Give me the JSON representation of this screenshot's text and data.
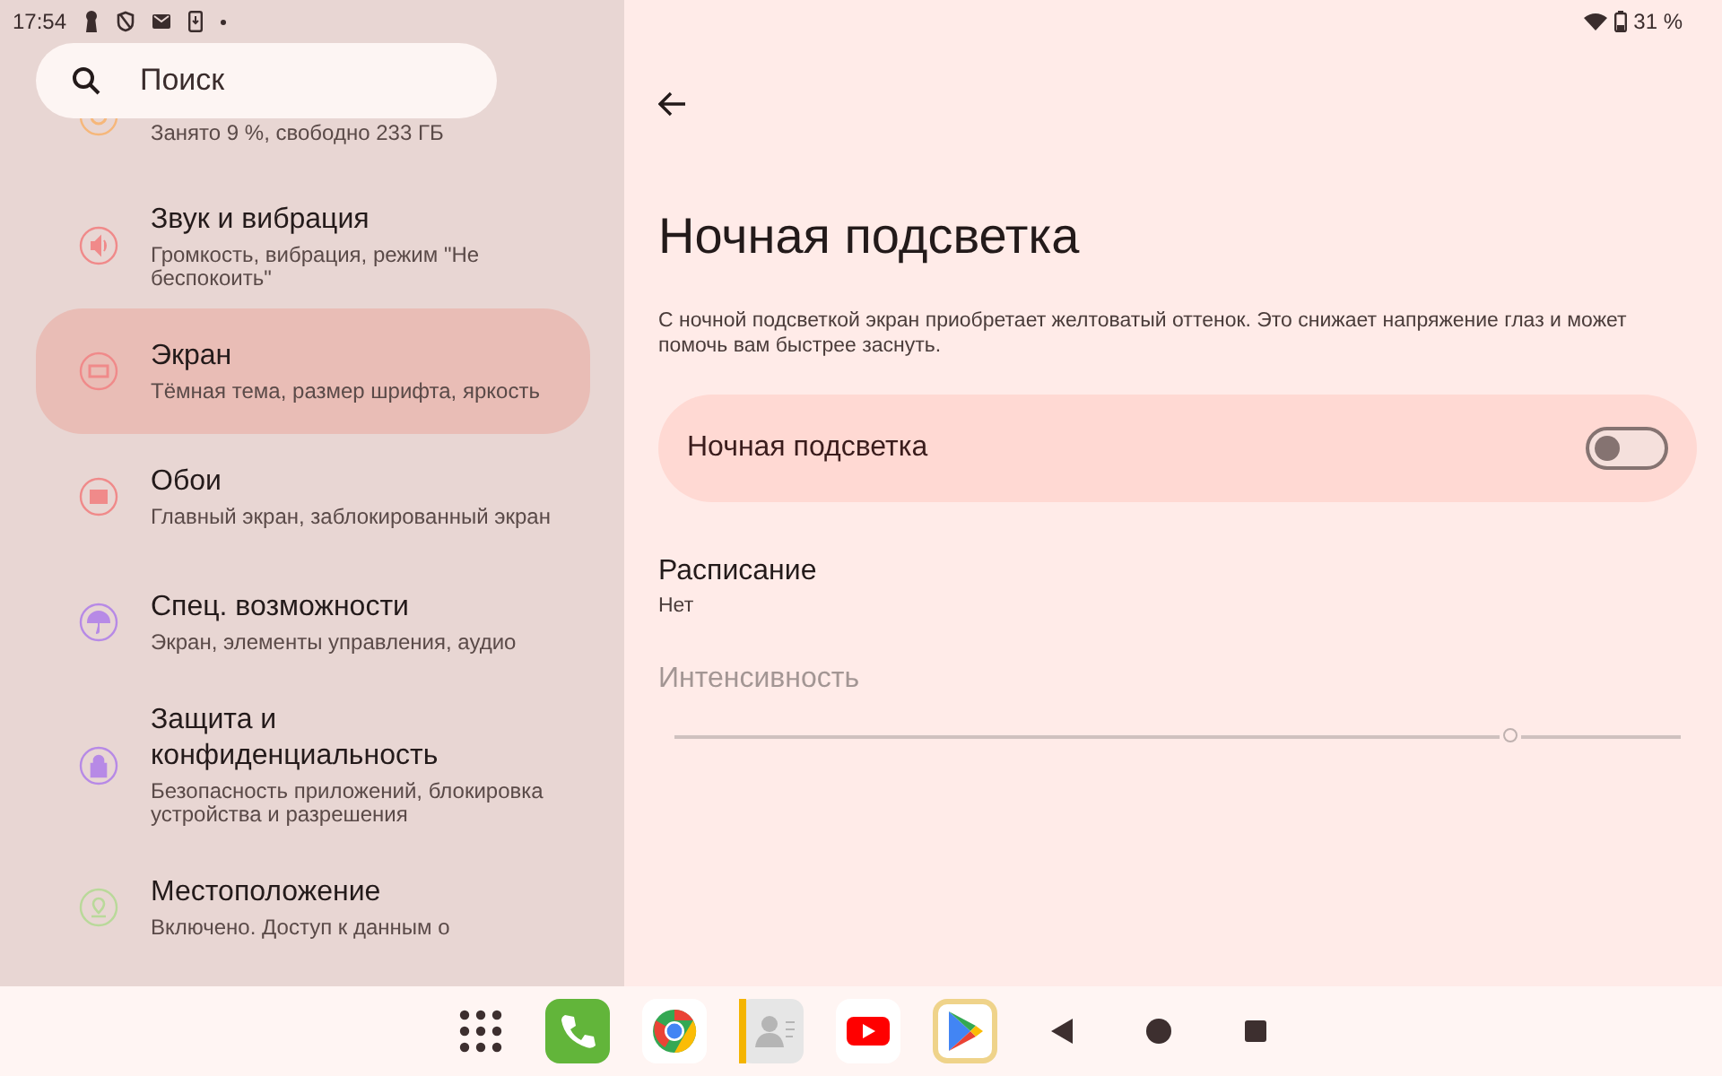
{
  "status_bar": {
    "time": "17:54",
    "battery": "31 %"
  },
  "search": {
    "placeholder": "Поиск"
  },
  "settings_list": [
    {
      "kind": "storage",
      "subtitle": "Занято 9 %, свободно 233 ГБ",
      "selected": false,
      "color": "#f6b77a"
    },
    {
      "kind": "sound",
      "title": "Звук и вибрация",
      "subtitle": "Громкость, вибрация, режим \"Не беспокоить\"",
      "selected": false,
      "color": "#f08a8a"
    },
    {
      "kind": "display",
      "title": "Экран",
      "subtitle": "Тёмная тема, размер шрифта, яркость",
      "selected": true,
      "color": "#f08a8a"
    },
    {
      "kind": "wallpaper",
      "title": "Обои",
      "subtitle": "Главный экран, заблокированный экран",
      "selected": false,
      "color": "#f08a8a"
    },
    {
      "kind": "accessibility",
      "title": "Спец. возможности",
      "subtitle": "Экран, элементы управления, аудио",
      "selected": false,
      "color": "#b78ae6"
    },
    {
      "kind": "security",
      "title": "Защита и конфиденциальность",
      "subtitle": "Безопасность приложений, блокировка устройства и разрешения",
      "selected": false,
      "color": "#b78ae6"
    },
    {
      "kind": "location",
      "title": "Местоположение",
      "subtitle": "Включено. Доступ к данным о",
      "selected": false,
      "color": "#b9d99a"
    }
  ],
  "detail": {
    "title": "Ночная подсветка",
    "description": "С ночной подсветкой экран приобретает желтоватый оттенок. Это снижает напряжение глаз и может помочь вам быстрее заснуть.",
    "toggle": {
      "label": "Ночная подсветка",
      "on": false
    },
    "schedule": {
      "title": "Расписание",
      "value": "Нет"
    },
    "intensity": {
      "label": "Интенсивность",
      "disabled": true,
      "level": 0.83
    }
  },
  "dock": [
    {
      "kind": "apps",
      "selected": false
    },
    {
      "kind": "phone",
      "selected": false
    },
    {
      "kind": "chrome",
      "selected": false
    },
    {
      "kind": "contacts",
      "selected": false
    },
    {
      "kind": "youtube",
      "selected": false
    },
    {
      "kind": "play",
      "selected": true
    }
  ],
  "nav": [
    {
      "kind": "back"
    },
    {
      "kind": "home"
    },
    {
      "kind": "recents"
    }
  ]
}
